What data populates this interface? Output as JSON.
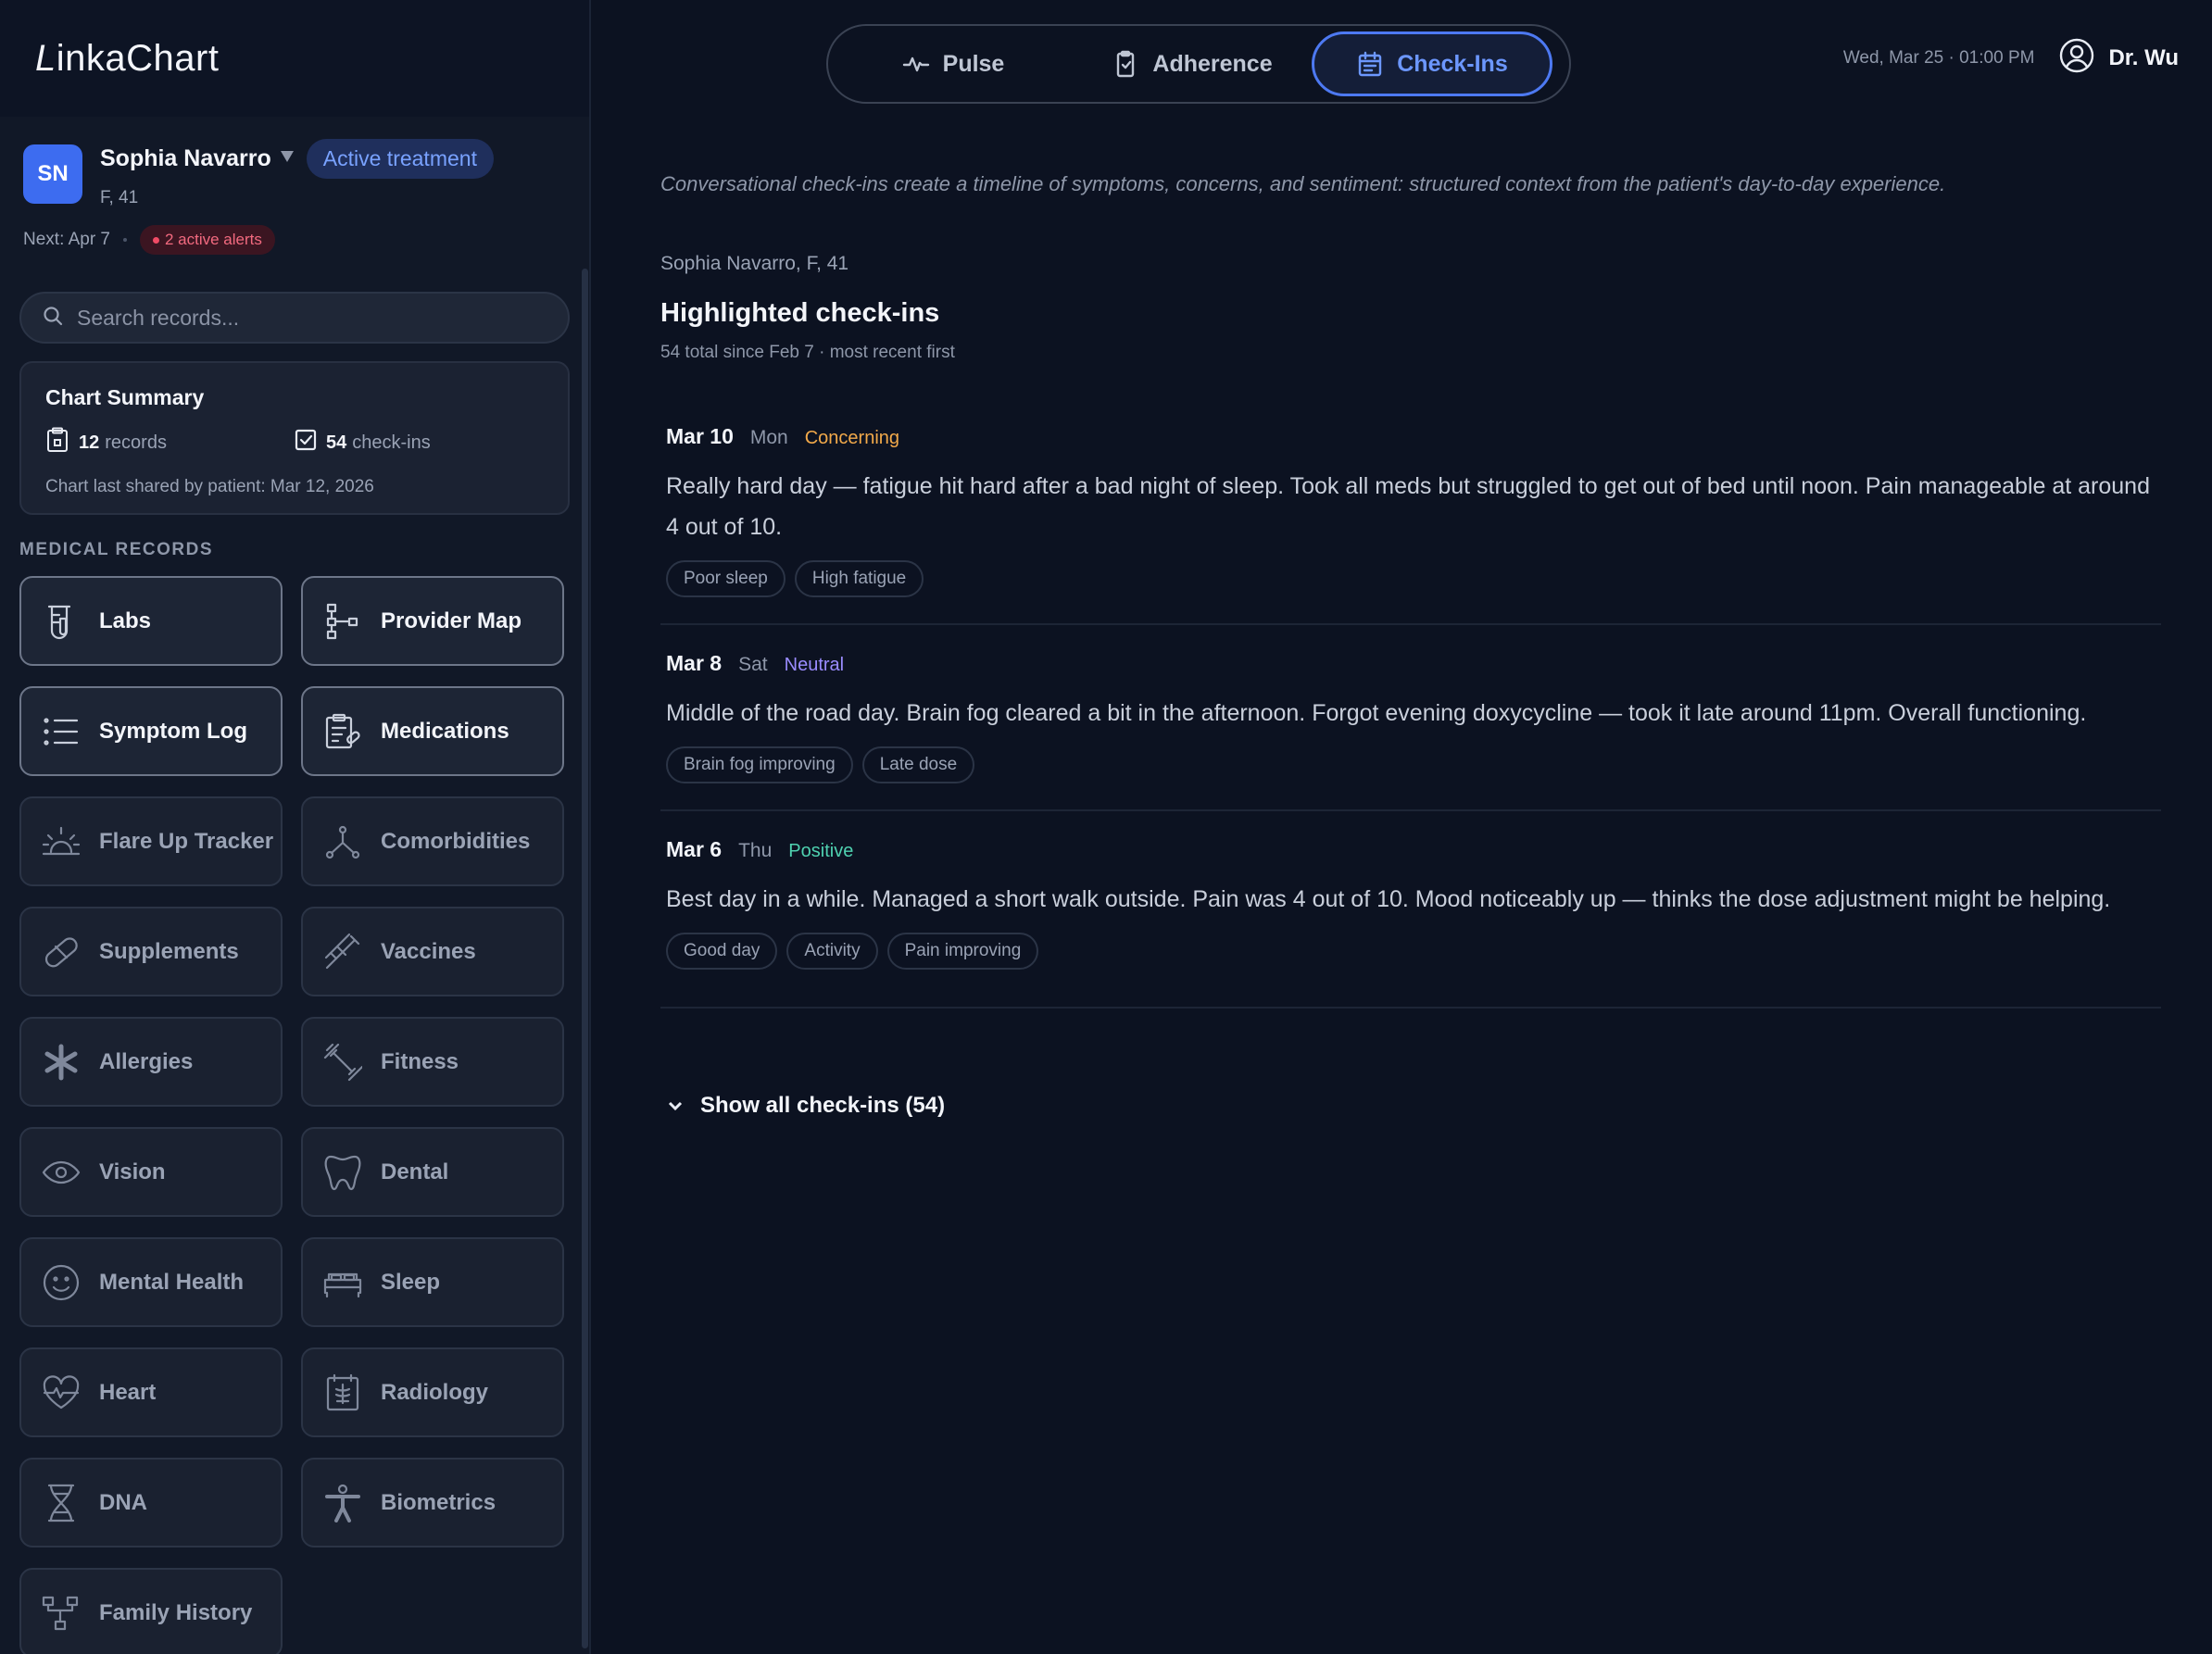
{
  "app": {
    "brand": "LinkaChart"
  },
  "patient": {
    "initials": "SN",
    "name": "Sophia Navarro",
    "status_badge": "Active treatment",
    "demographics": "F, 41",
    "next": "Next: Apr 7",
    "alerts": "2 active alerts"
  },
  "search": {
    "placeholder": "Search records..."
  },
  "summary": {
    "title": "Chart Summary",
    "records_count": "12",
    "records_label": "records",
    "checkins_count": "54",
    "checkins_label": "check-ins",
    "note": "Chart last shared by patient: Mar 12, 2026"
  },
  "records_section_label": "MEDICAL RECORDS",
  "records": [
    {
      "label": "Labs",
      "icon": "beaker-icon",
      "active": true
    },
    {
      "label": "Provider Map",
      "icon": "org-chart-icon",
      "active": true
    },
    {
      "label": "Symptom Log",
      "icon": "list-icon",
      "active": true
    },
    {
      "label": "Medications",
      "icon": "prescription-icon",
      "active": true
    },
    {
      "label": "Flare Up Tracker",
      "icon": "flare-icon",
      "active": false
    },
    {
      "label": "Comorbidities",
      "icon": "branch-icon",
      "active": false
    },
    {
      "label": "Supplements",
      "icon": "pill-icon",
      "active": false
    },
    {
      "label": "Vaccines",
      "icon": "syringe-icon",
      "active": false
    },
    {
      "label": "Allergies",
      "icon": "asterisk-icon",
      "active": false
    },
    {
      "label": "Fitness",
      "icon": "dumbbell-icon",
      "active": false
    },
    {
      "label": "Vision",
      "icon": "eye-icon",
      "active": false
    },
    {
      "label": "Dental",
      "icon": "tooth-icon",
      "active": false
    },
    {
      "label": "Mental Health",
      "icon": "smile-icon",
      "active": false
    },
    {
      "label": "Sleep",
      "icon": "bed-icon",
      "active": false
    },
    {
      "label": "Heart",
      "icon": "heart-pulse-icon",
      "active": false
    },
    {
      "label": "Radiology",
      "icon": "xray-icon",
      "active": false
    },
    {
      "label": "DNA",
      "icon": "dna-icon",
      "active": false
    },
    {
      "label": "Biometrics",
      "icon": "person-icon",
      "active": false
    },
    {
      "label": "Family History",
      "icon": "family-tree-icon",
      "active": false
    }
  ],
  "tabs": [
    {
      "label": "Pulse",
      "icon": "pulse-icon"
    },
    {
      "label": "Adherence",
      "icon": "clipboard-check-icon"
    },
    {
      "label": "Check-Ins",
      "icon": "calendar-icon",
      "selected": true
    }
  ],
  "header": {
    "datetime": "Wed, Mar 25 · 01:00 PM",
    "user": "Dr. Wu"
  },
  "main": {
    "intro": "Conversational check-ins create a timeline of symptoms, concerns, and sentiment: structured context from the patient's day-to-day experience.",
    "context": "Sophia Navarro, F, 41",
    "heading": "Highlighted check-ins",
    "subheading": "54 total since Feb 7 · most recent first",
    "show_all": "Show all check-ins (54)"
  },
  "checkins": [
    {
      "date": "Mar 10",
      "dow": "Mon",
      "sentiment": "Concerning",
      "sentiment_color": "#f2a94a",
      "text": "Really hard day — fatigue hit hard after a bad night of sleep. Took all meds but struggled to get out of bed until noon. Pain manageable at around 4 out of 10.",
      "tags": [
        "Poor sleep",
        "High fatigue"
      ]
    },
    {
      "date": "Mar 8",
      "dow": "Sat",
      "sentiment": "Neutral",
      "sentiment_color": "#9a8cff",
      "text": "Middle of the road day. Brain fog cleared a bit in the afternoon. Forgot evening doxycycline — took it late around 11pm. Overall functioning.",
      "tags": [
        "Brain fog improving",
        "Late dose"
      ]
    },
    {
      "date": "Mar 6",
      "dow": "Thu",
      "sentiment": "Positive",
      "sentiment_color": "#4fd1b0",
      "text": "Best day in a while. Managed a short walk outside. Pain was 4 out of 10. Mood noticeably up — thinks the dose adjustment might be helping.",
      "tags": [
        "Good day",
        "Activity",
        "Pain improving"
      ]
    }
  ]
}
